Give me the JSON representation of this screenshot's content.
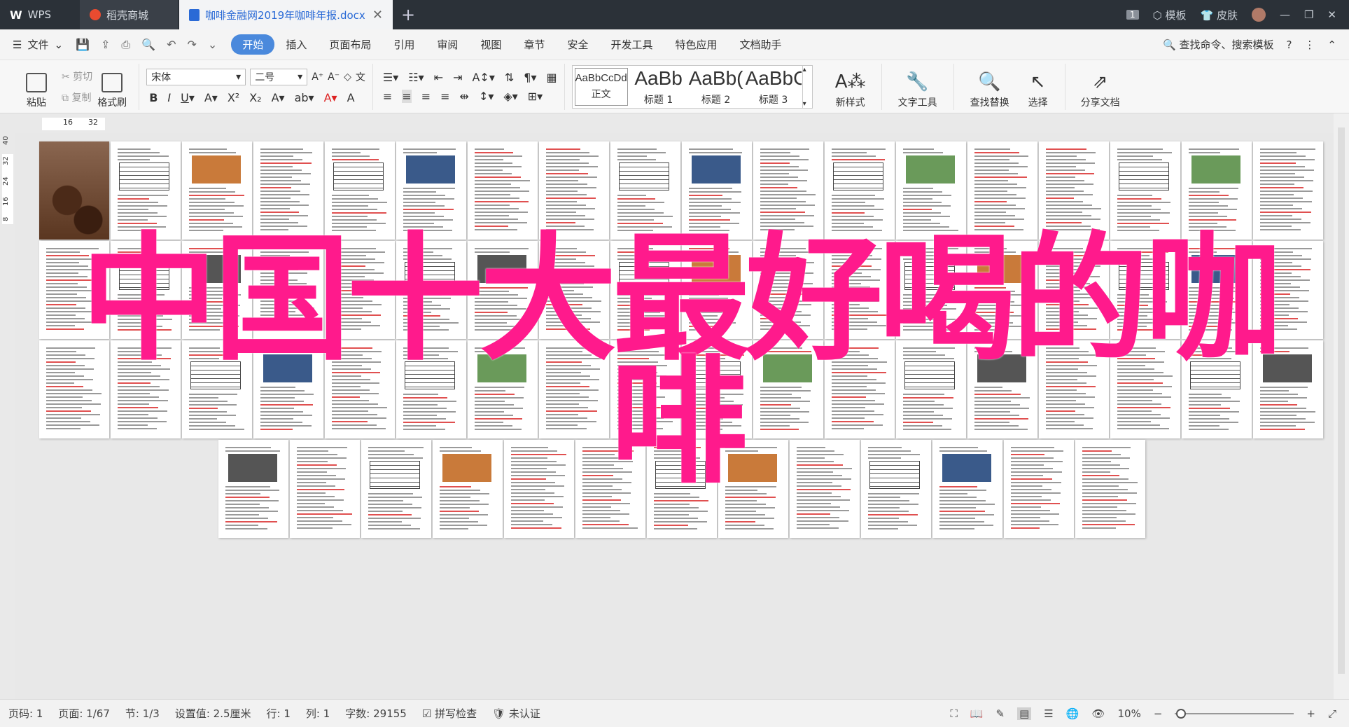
{
  "titlebar": {
    "app_label": "WPS",
    "tabs": [
      {
        "label": "稻壳商城"
      },
      {
        "label": "咖啡金融网2019年咖啡年报.docx"
      }
    ],
    "badge": "1",
    "template_label": "模板",
    "skin_label": "皮肤"
  },
  "menubar": {
    "file_label": "文件",
    "items": [
      "开始",
      "插入",
      "页面布局",
      "引用",
      "审阅",
      "视图",
      "章节",
      "安全",
      "开发工具",
      "特色应用",
      "文档助手"
    ],
    "active_index": 0,
    "search_label": "查找命令、搜索模板"
  },
  "ribbon": {
    "paste_label": "粘贴",
    "cut_label": "剪切",
    "copy_label": "复制",
    "format_painter_label": "格式刷",
    "font_name": "宋体",
    "font_size": "二号",
    "styles": [
      {
        "sample": "AaBbCcDd",
        "label": "正文"
      },
      {
        "sample": "AaBb",
        "label": "标题 1"
      },
      {
        "sample": "AaBb(",
        "label": "标题 2"
      },
      {
        "sample": "AaBbC",
        "label": "标题 3"
      }
    ],
    "new_style_label": "新样式",
    "text_tools_label": "文字工具",
    "find_replace_label": "查找替换",
    "select_label": "选择",
    "share_label": "分享文档"
  },
  "ruler": {
    "marks": [
      "16",
      "32"
    ],
    "left_marks": [
      "8",
      "16",
      "24",
      "32",
      "40"
    ]
  },
  "overlay": {
    "line1": "中国十大最好喝的咖",
    "line2": "啡"
  },
  "statusbar": {
    "page_code": "页码: 1",
    "page": "页面: 1/67",
    "section": "节: 1/3",
    "setting": "设置值: 2.5厘米",
    "row": "行: 1",
    "col": "列: 1",
    "word_count": "字数: 29155",
    "spell_check": "拼写检查",
    "auth": "未认证",
    "zoom": "10%"
  },
  "colors": {
    "accent": "#4a89dc",
    "overlay": "#ff1a8c",
    "titlebar": "#2b3138"
  }
}
